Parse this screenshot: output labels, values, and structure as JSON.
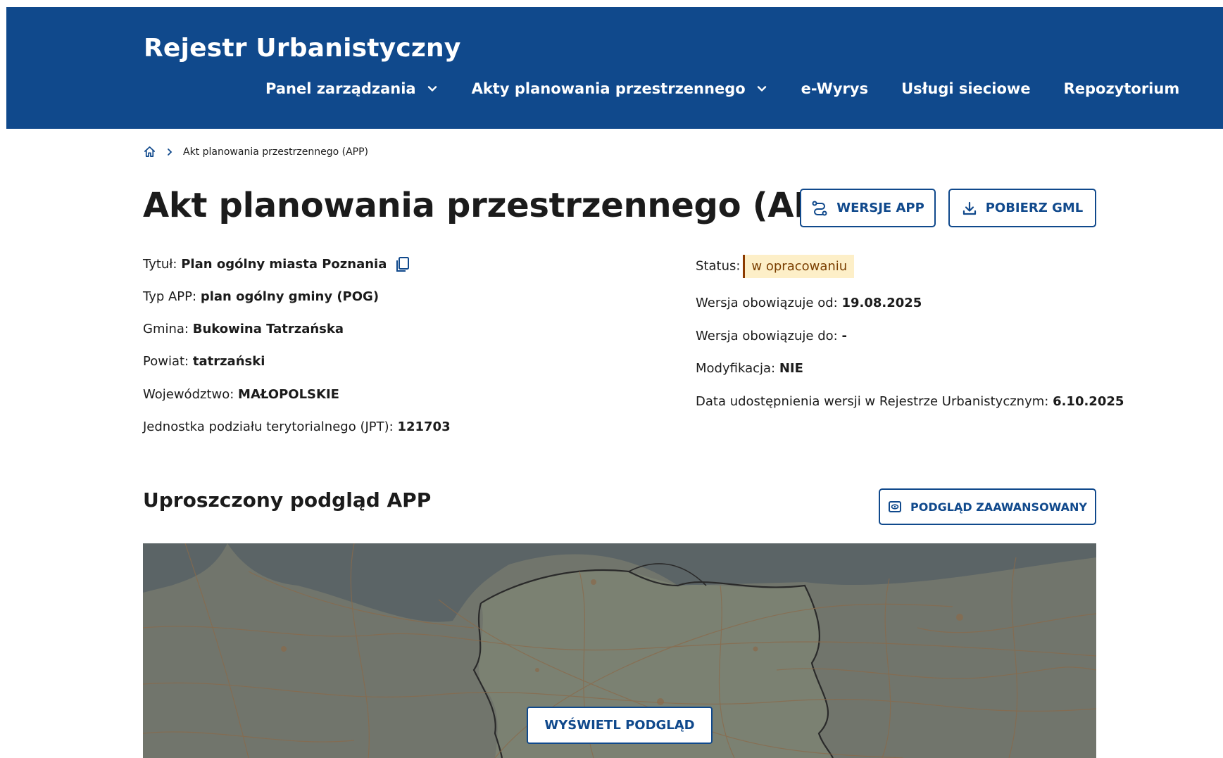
{
  "header": {
    "brand": "Rejestr Urbanistyczny",
    "nav": [
      {
        "label": "Panel zarządzania",
        "dropdown": true
      },
      {
        "label": "Akty planowania przestrzennego",
        "dropdown": true
      },
      {
        "label": "e-Wyrys",
        "dropdown": false
      },
      {
        "label": "Usługi sieciowe",
        "dropdown": false
      },
      {
        "label": "Repozytorium",
        "dropdown": false
      }
    ]
  },
  "breadcrumb": {
    "home_icon": "home-icon",
    "current": "Akt planowania przestrzennego (APP)"
  },
  "page": {
    "title": "Akt planowania przestrzennego (APP)",
    "buttons": {
      "versions": "WERSJE APP",
      "download": "POBIERZ GML"
    }
  },
  "details_left": [
    {
      "label": "Tytuł:",
      "value": "Plan ogólny miasta Poznania",
      "copy": true
    },
    {
      "label": "Typ APP:",
      "value": "plan ogólny gminy (POG)"
    },
    {
      "label": "Gmina:",
      "value": "Bukowina Tatrzańska"
    },
    {
      "label": "Powiat:",
      "value": "tatrzański"
    },
    {
      "label": "Województwo:",
      "value": "MAŁOPOLSKIE"
    },
    {
      "label": "Jednostka podziału terytorialnego (JPT):",
      "value": "121703"
    }
  ],
  "details_right": {
    "status": {
      "label": "Status:",
      "value": "w opracowaniu"
    },
    "rows": [
      {
        "label": "Wersja obowiązuje od:",
        "value": "19.08.2025"
      },
      {
        "label": "Wersja obowiązuje do:",
        "value": "-"
      },
      {
        "label": "Modyfikacja:",
        "value": "NIE"
      },
      {
        "label": "Data udostępnienia wersji w Rejestrze Urbanistycznym:",
        "value": "6.10.2025"
      }
    ]
  },
  "preview": {
    "title": "Uproszczony podgląd APP",
    "advanced_button": "PODGLĄD ZAAWANSOWANY",
    "show_button": "WYŚWIETL PODGLĄD"
  },
  "colors": {
    "primary": "#10498c",
    "status_bg": "#fdefc8",
    "status_text": "#7a3e00"
  }
}
